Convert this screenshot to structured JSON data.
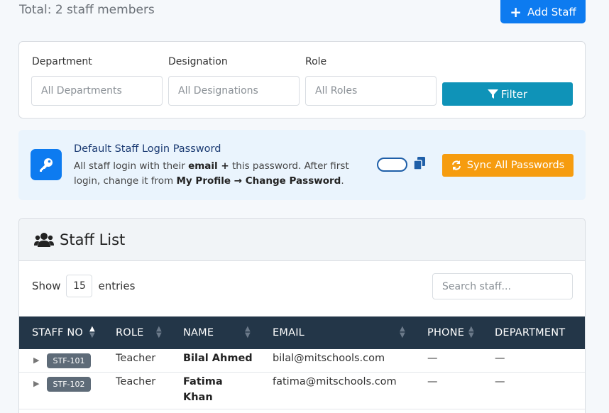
{
  "header": {
    "total_text": "Total: 2 staff members",
    "add_label": "Add Staff"
  },
  "filters": {
    "department_label": "Department",
    "department_value": "All Departments",
    "designation_label": "Designation",
    "designation_value": "All Designations",
    "role_label": "Role",
    "role_value": "All Roles",
    "filter_label": "Filter"
  },
  "password": {
    "title": "Default Staff Login Password",
    "desc_1": "All staff login with their ",
    "desc_email": "email +",
    "desc_2": " this password. After first login, change it from ",
    "desc_path": "My Profile → Change Password",
    "desc_3": ".",
    "sync_label": "Sync All Passwords"
  },
  "list": {
    "title": "Staff List",
    "show_label": "Show",
    "entries_value": "15",
    "entries_label": "entries",
    "search_placeholder": "Search staff...",
    "columns": [
      "STAFF NO",
      "ROLE",
      "NAME",
      "EMAIL",
      "PHONE",
      "DEPARTMENT"
    ],
    "rows": [
      {
        "staff_no": "STF-101",
        "role": "Teacher",
        "name": "Bilal Ahmed",
        "email": "bilal@mitschools.com",
        "phone": "—",
        "department": "—"
      },
      {
        "staff_no": "STF-102",
        "role": "Teacher",
        "name": "Fatima Khan",
        "email": "fatima@mitschools.com",
        "phone": "—",
        "department": "—"
      }
    ]
  },
  "colors": {
    "primary": "#0d7bf0",
    "filter": "#0f93b8",
    "sync": "#f69c0f",
    "table_header": "#233648"
  }
}
